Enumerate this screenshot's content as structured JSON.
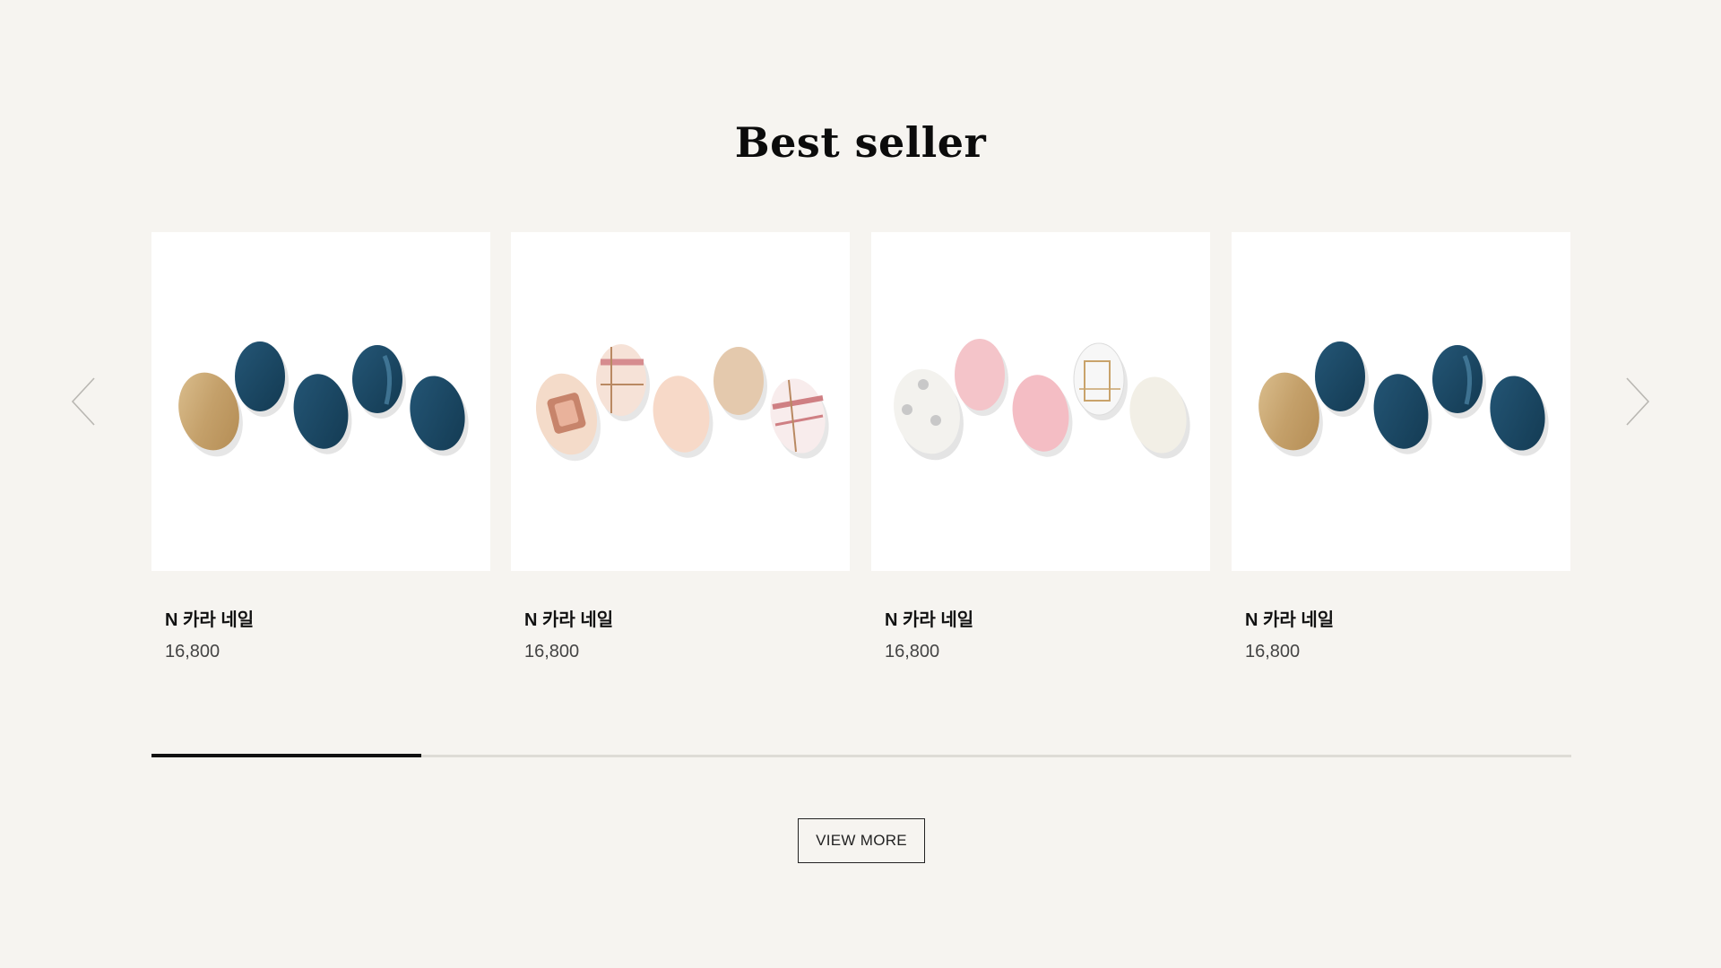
{
  "section": {
    "title": "Best seller"
  },
  "carousel": {
    "prev_icon": "chevron-left-icon",
    "next_icon": "chevron-right-icon",
    "progress_fraction": 0.19
  },
  "products": [
    {
      "name": "N 카라 네일",
      "price": "16,800",
      "image": "navy-gold-nails"
    },
    {
      "name": "N 카라 네일",
      "price": "16,800",
      "image": "beige-check-nails"
    },
    {
      "name": "N 카라 네일",
      "price": "16,800",
      "image": "pink-white-nails"
    },
    {
      "name": "N 카라 네일",
      "price": "16,800",
      "image": "navy-gold-nails"
    }
  ],
  "actions": {
    "view_more": "VIEW MORE"
  },
  "colors": {
    "background": "#f6f4f0",
    "card": "#ffffff",
    "navy": "#1a4763",
    "gold": "#c9a36b",
    "progress_track": "#dedcd6",
    "progress_fill": "#111111"
  }
}
